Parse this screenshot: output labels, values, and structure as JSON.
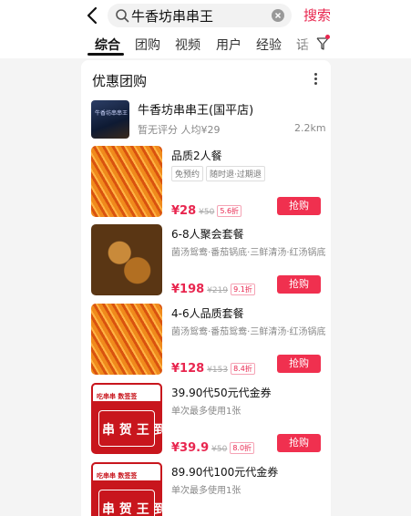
{
  "search": {
    "query": "牛香坊串串王",
    "button": "搜索"
  },
  "tabs": [
    "综合",
    "团购",
    "视频",
    "用户",
    "经验",
    "话"
  ],
  "card": {
    "title": "优惠团购",
    "shop": {
      "thumb_text": "牛香坊串串王",
      "name": "牛香坊串串王(国平店)",
      "meta": "暂无评分 人均¥29",
      "distance": "2.2km"
    },
    "deals": [
      {
        "name": "品质2人餐",
        "tags": [
          "免预约",
          "随时退·过期退"
        ],
        "desc": "",
        "price": "¥28",
        "orig": "¥50",
        "discount": "5.6折",
        "buy": "抢购",
        "image": "spicy"
      },
      {
        "name": "6-8人聚会套餐",
        "tags": [],
        "desc": "菌汤鸳鸯·番茄锅底·三鲜清汤·红汤锅底",
        "price": "¥198",
        "orig": "¥219",
        "discount": "9.1折",
        "buy": "抢购",
        "image": "feet"
      },
      {
        "name": "4-6人品质套餐",
        "tags": [],
        "desc": "菌汤鸳鸯·番茄鸳鸯·三鲜清汤·红汤锅底",
        "price": "¥128",
        "orig": "¥153",
        "discount": "8.4折",
        "buy": "抢购",
        "image": "spicy"
      },
      {
        "name": "39.90代50元代金券",
        "tags": [],
        "desc": "单次最多使用1张",
        "price": "¥39.9",
        "orig": "¥50",
        "discount": "8.0折",
        "buy": "抢购",
        "image": "coupon"
      },
      {
        "name": "89.90代100元代金券",
        "tags": [],
        "desc": "单次最多使用1张",
        "price": "",
        "orig": "",
        "discount": "",
        "buy": "",
        "image": "coupon"
      }
    ],
    "coupon_image": {
      "banner": "吃串串 数签签",
      "body": "串 贺 王 到"
    }
  },
  "colors": {
    "accent": "#e8264f",
    "button": "#f0304f"
  },
  "icons": {
    "back": "back-arrow-icon",
    "search": "search-icon",
    "clear": "clear-icon",
    "filter": "filter-icon",
    "more": "more-vertical-icon"
  }
}
